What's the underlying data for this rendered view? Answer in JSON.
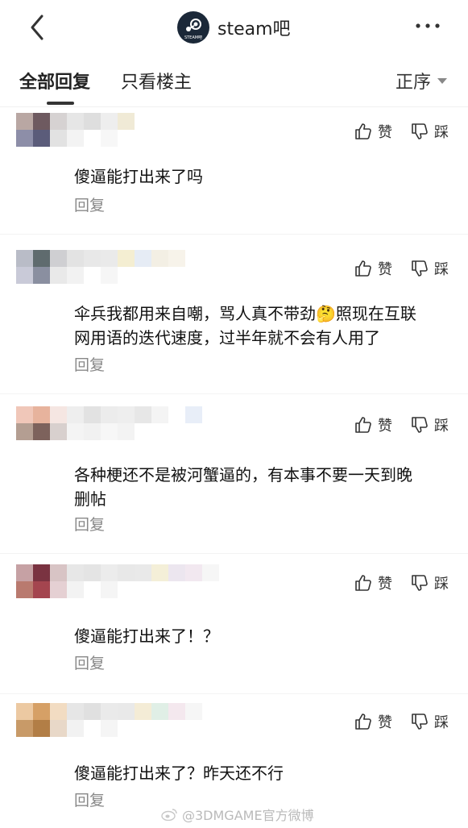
{
  "header": {
    "brand_title": "steam吧",
    "logo_text": "STEAM吧"
  },
  "tabs": {
    "all_replies": "全部回复",
    "owner_only": "只看楼主",
    "sort_label": "正序"
  },
  "actions": {
    "like": "赞",
    "dislike": "踩",
    "reply": "回复"
  },
  "comments": [
    {
      "text_lines": [
        "傻逼能打出来了吗"
      ]
    },
    {
      "text_lines": [
        "伞兵我都用来自嘲，骂人真不带劲🤔照现在互联",
        "网用语的迭代速度，过半年就不会有人用了"
      ]
    },
    {
      "text_lines": [
        "各种梗还不是被河蟹逼的，有本事不要一天到晚",
        "删帖"
      ]
    },
    {
      "text_lines": [
        "傻逼能打出来了！？"
      ]
    },
    {
      "text_lines": [
        "傻逼能打出来了？昨天还不行"
      ]
    }
  ],
  "watermark": "@3DMGAME官方微博",
  "colors": {
    "steam_logo_bg": "#1b2838",
    "muted": "#888888"
  }
}
